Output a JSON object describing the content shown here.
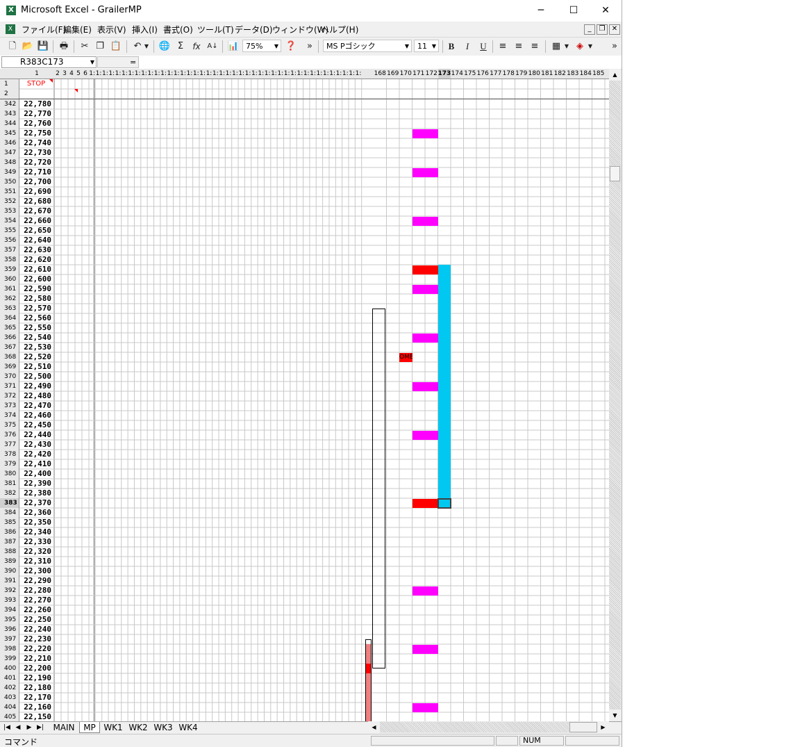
{
  "window": {
    "title": "Microsoft Excel - GrailerMP",
    "min_glyph": "─",
    "max_glyph": "☐",
    "close_glyph": "✕"
  },
  "menu": {
    "items": [
      "ファイル(F)",
      "編集(E)",
      "表示(V)",
      "挿入(I)",
      "書式(O)",
      "ツール(T)",
      "データ(D)",
      "ウィンドウ(W)",
      "ヘルプ(H)"
    ],
    "mdi_min": "_",
    "mdi_restore": "❐",
    "mdi_close": "✕"
  },
  "toolbar": {
    "zoom": "75%",
    "font_name": "MS Pゴシック",
    "font_size": "11",
    "bold": "B",
    "italic": "I",
    "underline": "U",
    "icons": [
      "new-document-icon",
      "open-folder-icon",
      "save-icon",
      "print-icon",
      "cut-icon",
      "copy-icon",
      "paste-icon",
      "undo-icon",
      "web-icon",
      "autosum-icon",
      "function-icon",
      "sort-icon",
      "chart-icon",
      "help-icon",
      "align-left-icon",
      "align-center-icon",
      "align-right-icon",
      "borders-icon",
      "fill-color-icon"
    ]
  },
  "formula_bar": {
    "name_box": "R383C173",
    "equals": "=",
    "content": ""
  },
  "sheet": {
    "column_headers": [
      "1",
      "2",
      "3",
      "4",
      "5",
      "6",
      "1:",
      "1:",
      "1:",
      "1:",
      "1:",
      "1:",
      "1:",
      "1:",
      "1:",
      "1:",
      "1:",
      "1:",
      "1:",
      "1:",
      "1:",
      "1:",
      "1:",
      "1:",
      "1:",
      "1:",
      "1:",
      "1:",
      "1:",
      "1:",
      "1:",
      "1:",
      "1:",
      "1:",
      "1:",
      "1:",
      "1:",
      "1:",
      "1:",
      "1:",
      "1:",
      "1:",
      "1:",
      "1:",
      "1:",
      "1:",
      "1:",
      "1:",
      "168",
      "169",
      "170",
      "171",
      "172",
      "173",
      "174",
      "175",
      "176",
      "177",
      "178",
      "179",
      "180",
      "181",
      "182",
      "183",
      "184",
      "185"
    ],
    "header_rows": [
      {
        "num": "1",
        "label": "STOP"
      },
      {
        "num": "2",
        "label": ""
      }
    ],
    "rows": [
      {
        "num": "342",
        "val": "22,780"
      },
      {
        "num": "343",
        "val": "22,770"
      },
      {
        "num": "344",
        "val": "22,760"
      },
      {
        "num": "345",
        "val": "22,750"
      },
      {
        "num": "346",
        "val": "22,740"
      },
      {
        "num": "347",
        "val": "22,730"
      },
      {
        "num": "348",
        "val": "22,720"
      },
      {
        "num": "349",
        "val": "22,710"
      },
      {
        "num": "350",
        "val": "22,700"
      },
      {
        "num": "351",
        "val": "22,690"
      },
      {
        "num": "352",
        "val": "22,680"
      },
      {
        "num": "353",
        "val": "22,670"
      },
      {
        "num": "354",
        "val": "22,660"
      },
      {
        "num": "355",
        "val": "22,650"
      },
      {
        "num": "356",
        "val": "22,640"
      },
      {
        "num": "357",
        "val": "22,630"
      },
      {
        "num": "358",
        "val": "22,620"
      },
      {
        "num": "359",
        "val": "22,610"
      },
      {
        "num": "360",
        "val": "22,600"
      },
      {
        "num": "361",
        "val": "22,590"
      },
      {
        "num": "362",
        "val": "22,580"
      },
      {
        "num": "363",
        "val": "22,570"
      },
      {
        "num": "364",
        "val": "22,560"
      },
      {
        "num": "365",
        "val": "22,550"
      },
      {
        "num": "366",
        "val": "22,540"
      },
      {
        "num": "367",
        "val": "22,530"
      },
      {
        "num": "368",
        "val": "22,520"
      },
      {
        "num": "369",
        "val": "22,510"
      },
      {
        "num": "370",
        "val": "22,500"
      },
      {
        "num": "371",
        "val": "22,490"
      },
      {
        "num": "372",
        "val": "22,480"
      },
      {
        "num": "373",
        "val": "22,470"
      },
      {
        "num": "374",
        "val": "22,460"
      },
      {
        "num": "375",
        "val": "22,450"
      },
      {
        "num": "376",
        "val": "22,440"
      },
      {
        "num": "377",
        "val": "22,430"
      },
      {
        "num": "378",
        "val": "22,420"
      },
      {
        "num": "379",
        "val": "22,410"
      },
      {
        "num": "380",
        "val": "22,400"
      },
      {
        "num": "381",
        "val": "22,390"
      },
      {
        "num": "382",
        "val": "22,380"
      },
      {
        "num": "383",
        "val": "22,370"
      },
      {
        "num": "384",
        "val": "22,360"
      },
      {
        "num": "385",
        "val": "22,350"
      },
      {
        "num": "386",
        "val": "22,340"
      },
      {
        "num": "387",
        "val": "22,330"
      },
      {
        "num": "388",
        "val": "22,320"
      },
      {
        "num": "389",
        "val": "22,310"
      },
      {
        "num": "390",
        "val": "22,300"
      },
      {
        "num": "391",
        "val": "22,290"
      },
      {
        "num": "392",
        "val": "22,280"
      },
      {
        "num": "393",
        "val": "22,270"
      },
      {
        "num": "394",
        "val": "22,260"
      },
      {
        "num": "395",
        "val": "22,250"
      },
      {
        "num": "396",
        "val": "22,240"
      },
      {
        "num": "397",
        "val": "22,230"
      },
      {
        "num": "398",
        "val": "22,220"
      },
      {
        "num": "399",
        "val": "22,210"
      },
      {
        "num": "400",
        "val": "22,200"
      },
      {
        "num": "401",
        "val": "22,190"
      },
      {
        "num": "402",
        "val": "22,180"
      },
      {
        "num": "403",
        "val": "22,170"
      },
      {
        "num": "404",
        "val": "22,160"
      },
      {
        "num": "405",
        "val": "22,150"
      }
    ],
    "active_row": "383",
    "active_col": "173",
    "magenta_marks_rows": [
      "345",
      "349",
      "354",
      "361",
      "366",
      "371",
      "376",
      "392",
      "398",
      "404"
    ],
    "red_marks_rows": [
      "359",
      "383"
    ],
    "cyan_bar_rows": [
      "359",
      "383"
    ],
    "candle_body_rows": [
      "363",
      "400"
    ],
    "candle_wick_rows": [
      "397",
      "405"
    ],
    "ome_label": "OME",
    "ome_row": "368",
    "colors": {
      "magenta": "#ff00ff",
      "red": "#ff0000",
      "cyan": "#00c8f0",
      "pink": "#f08080",
      "stop_text": "#ff0000"
    }
  },
  "tabs": {
    "items": [
      "MAIN",
      "MP",
      "WK1",
      "WK2",
      "WK3",
      "WK4"
    ],
    "active": "MP"
  },
  "status": {
    "mode": "コマンド",
    "num": "NUM"
  }
}
